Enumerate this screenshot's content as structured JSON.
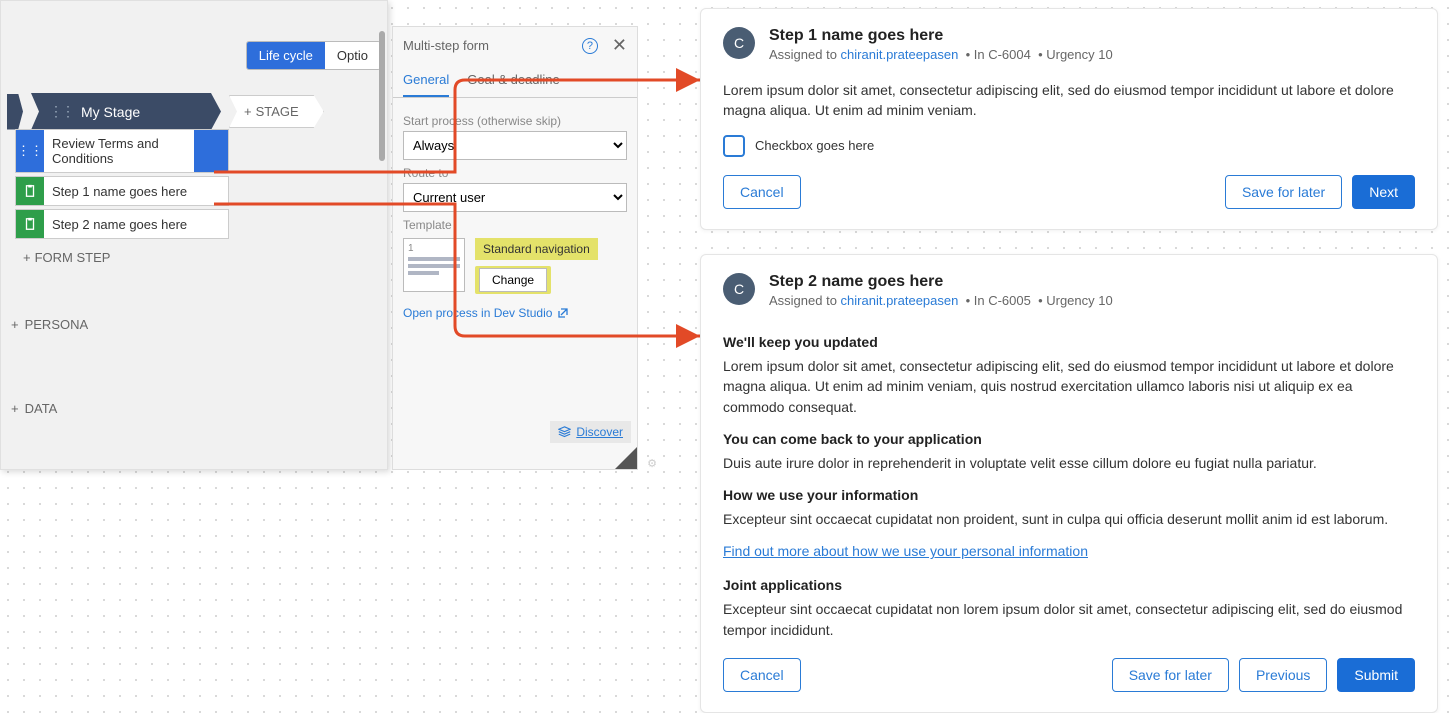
{
  "topTabs": {
    "lifecycle": "Life cycle",
    "optional": "Optio"
  },
  "stage": {
    "name": "My Stage",
    "addStage": "STAGE",
    "steps": {
      "review": "Review Terms and Conditions",
      "s1": "Step 1 name goes here",
      "s2": "Step 2 name goes here",
      "addFormStep": "FORM STEP"
    }
  },
  "rows": {
    "persona": "PERSONA",
    "data": "DATA"
  },
  "config": {
    "title": "Multi-step form",
    "tabs": {
      "general": "General",
      "goal": "Goal & deadline"
    },
    "startLabel": "Start process (otherwise skip)",
    "startValue": "Always",
    "routeLabel": "Route to",
    "routeValue": "Current user",
    "templateLabel": "Template",
    "templatePage": "1",
    "stdNav": "Standard navigation",
    "change": "Change",
    "openDev": "Open process in Dev Studio",
    "discover": "Discover"
  },
  "card1": {
    "avatar": "C",
    "title": "Step 1 name goes here",
    "assignedPrefix": "Assigned to ",
    "assignee": "chiranit.prateepasen",
    "caseRef": "In C-6004",
    "urgency": "Urgency 10",
    "body": "Lorem ipsum dolor sit amet, consectetur adipiscing elit, sed do eiusmod tempor incididunt ut labore et dolore magna aliqua. Ut enim ad minim veniam.",
    "checkboxLabel": "Checkbox goes here",
    "cancel": "Cancel",
    "save": "Save for later",
    "next": "Next"
  },
  "card2": {
    "avatar": "C",
    "title": "Step 2 name goes here",
    "assignedPrefix": "Assigned to ",
    "assignee": "chiranit.prateepasen",
    "caseRef": "In C-6005",
    "urgency": "Urgency 10",
    "h1": "We'll keep you updated",
    "p1": "Lorem ipsum dolor sit amet, consectetur adipiscing elit, sed do eiusmod tempor incididunt ut labore et dolore magna aliqua. Ut enim ad minim veniam, quis nostrud exercitation ullamco laboris nisi ut aliquip ex ea commodo consequat.",
    "h2": "You can come back to your application",
    "p2": "Duis aute irure dolor in reprehenderit in voluptate velit esse cillum dolore eu fugiat nulla pariatur.",
    "h3": "How we use your information",
    "p3": "Excepteur sint occaecat cupidatat non proident, sunt in culpa qui officia deserunt mollit anim id est laborum.",
    "link": "Find out more about how we use your personal information",
    "h4": "Joint applications",
    "p4": "Excepteur sint occaecat cupidatat non lorem ipsum dolor sit amet, consectetur adipiscing elit, sed do eiusmod tempor incididunt.",
    "cancel": "Cancel",
    "save": "Save for later",
    "previous": "Previous",
    "submit": "Submit"
  }
}
